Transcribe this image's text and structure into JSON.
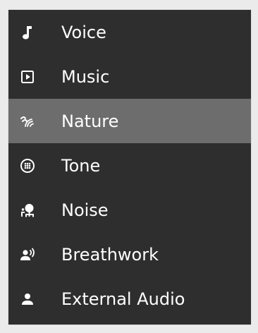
{
  "menu": {
    "selected_index": 2,
    "items": [
      {
        "label": "Voice",
        "icon": "music-note-icon"
      },
      {
        "label": "Music",
        "icon": "play-box-icon"
      },
      {
        "label": "Nature",
        "icon": "wind-waves-icon"
      },
      {
        "label": "Tone",
        "icon": "dots-circle-icon"
      },
      {
        "label": "Noise",
        "icon": "tree-bench-icon"
      },
      {
        "label": "Breathwork",
        "icon": "person-sound-icon"
      },
      {
        "label": "External Audio",
        "icon": "person-icon"
      }
    ]
  },
  "colors": {
    "menu_background": "#2e2e2e",
    "selected_background": "#6d6d6d",
    "text": "#ffffff",
    "page_background": "#ebebeb"
  }
}
